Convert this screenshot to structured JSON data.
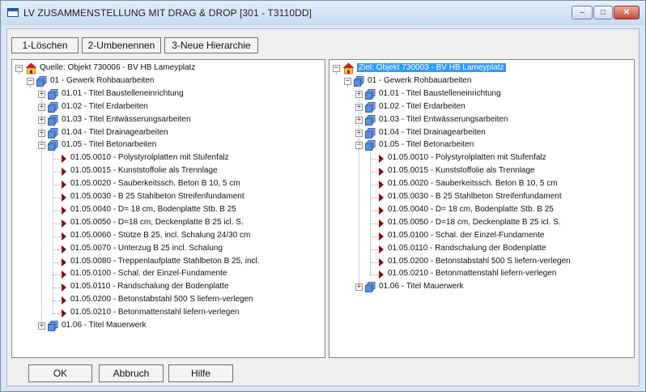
{
  "window": {
    "title": "LV ZUSAMMENSTELLUNG MIT DRAG & DROP  [301 - T3110DD]",
    "minimize_glyph": "–",
    "maximize_glyph": "□",
    "close_glyph": "✕"
  },
  "toolbar": {
    "delete_label": "1-Löschen",
    "rename_label": "2-Umbenennen",
    "new_hierarchy_label": "3-Neue Hierarchie"
  },
  "tree_left": {
    "root": "Quelle: Objekt 730006 - BV HB Lameyplatz",
    "gewerk": "01 - Gewerk Rohbauarbeiten",
    "titles": [
      "01.01 - Titel Baustelleneinrichtung",
      "01.02 - Titel Erdarbeiten",
      "01.03 - Titel Entwässerungsarbeiten",
      "01.04 - Titel Drainagearbeiten",
      "01.05 - Titel Betonarbeiten"
    ],
    "positions": [
      "01.05.0010 - Polystyrolplatten mit Stufenfalz",
      "01.05.0015 - Kunststoffolie als Trennlage",
      "01.05.0020 - Sauberkeitssch. Beton B 10, 5 cm",
      "01.05.0030 - B 25 Stahlbeton Streifenfundament",
      "01.05.0040 - D= 18 cm, Bodenplatte Stb. B 25",
      "01.05.0050 - D=18 cm, Deckenplatte B 25 icl. S.",
      "01.05.0060 - Stütze B 25, incl. Schalung 24/30 cm",
      "01.05.0070 - Unterzug B 25 incl. Schalung",
      "01.05.0080 - Treppenlaufplatte Stahlbeton B 25, incl.",
      "01.05.0100 - Schal. der Einzel-Fundamente",
      "01.05.0110 - Randschalung der Bodenplatte",
      "01.05.0200 - Betonstabstahl 500 S liefern-verlegen",
      "01.05.0210 - Betonmattenstahl liefern-verlegen"
    ],
    "last_title": "01.06 - Titel Mauerwerk"
  },
  "tree_right": {
    "root": "Ziel: Objekt 730003 - BV HB Lameyplatz",
    "gewerk": "01 - Gewerk Rohbauarbeiten",
    "titles": [
      "01.01 - Titel Baustelleneinrichtung",
      "01.02 - Titel Erdarbeiten",
      "01.03 - Titel Entwässerungsarbeiten",
      "01.04 - Titel Drainagearbeiten",
      "01.05 - Titel Betonarbeiten"
    ],
    "positions": [
      "01.05.0010 - Polystyrolplatten mit Stufenfalz",
      "01.05.0015 - Kunststoffolie als Trennlage",
      "01.05.0020 - Sauberkeitssch. Beton B 10, 5 cm",
      "01.05.0030 - B 25 Stahlbeton Streifenfundament",
      "01.05.0040 - D= 18 cm, Bodenplatte Stb. B 25",
      "01.05.0050 - D=18 cm, Deckenplatte B 25 icl. S.",
      "01.05.0100 - Schal. der Einzel-Fundamente",
      "01.05.0110 - Randschalung der Bodenplatte",
      "01.05.0200 - Betonstabstahl 500 S liefern-verlegen",
      "01.05.0210 - Betonmattenstahl liefern-verlegen"
    ],
    "last_title": "01.06 - Titel Mauerwerk"
  },
  "buttons": {
    "ok_label": "OK",
    "cancel_label": "Abbruch",
    "help_label": "Hilfe"
  },
  "colors": {
    "selection": "#3399ff",
    "position_marker": "#8b0000",
    "house_roof": "#c81e1e",
    "folder": "#2f5fb3"
  }
}
